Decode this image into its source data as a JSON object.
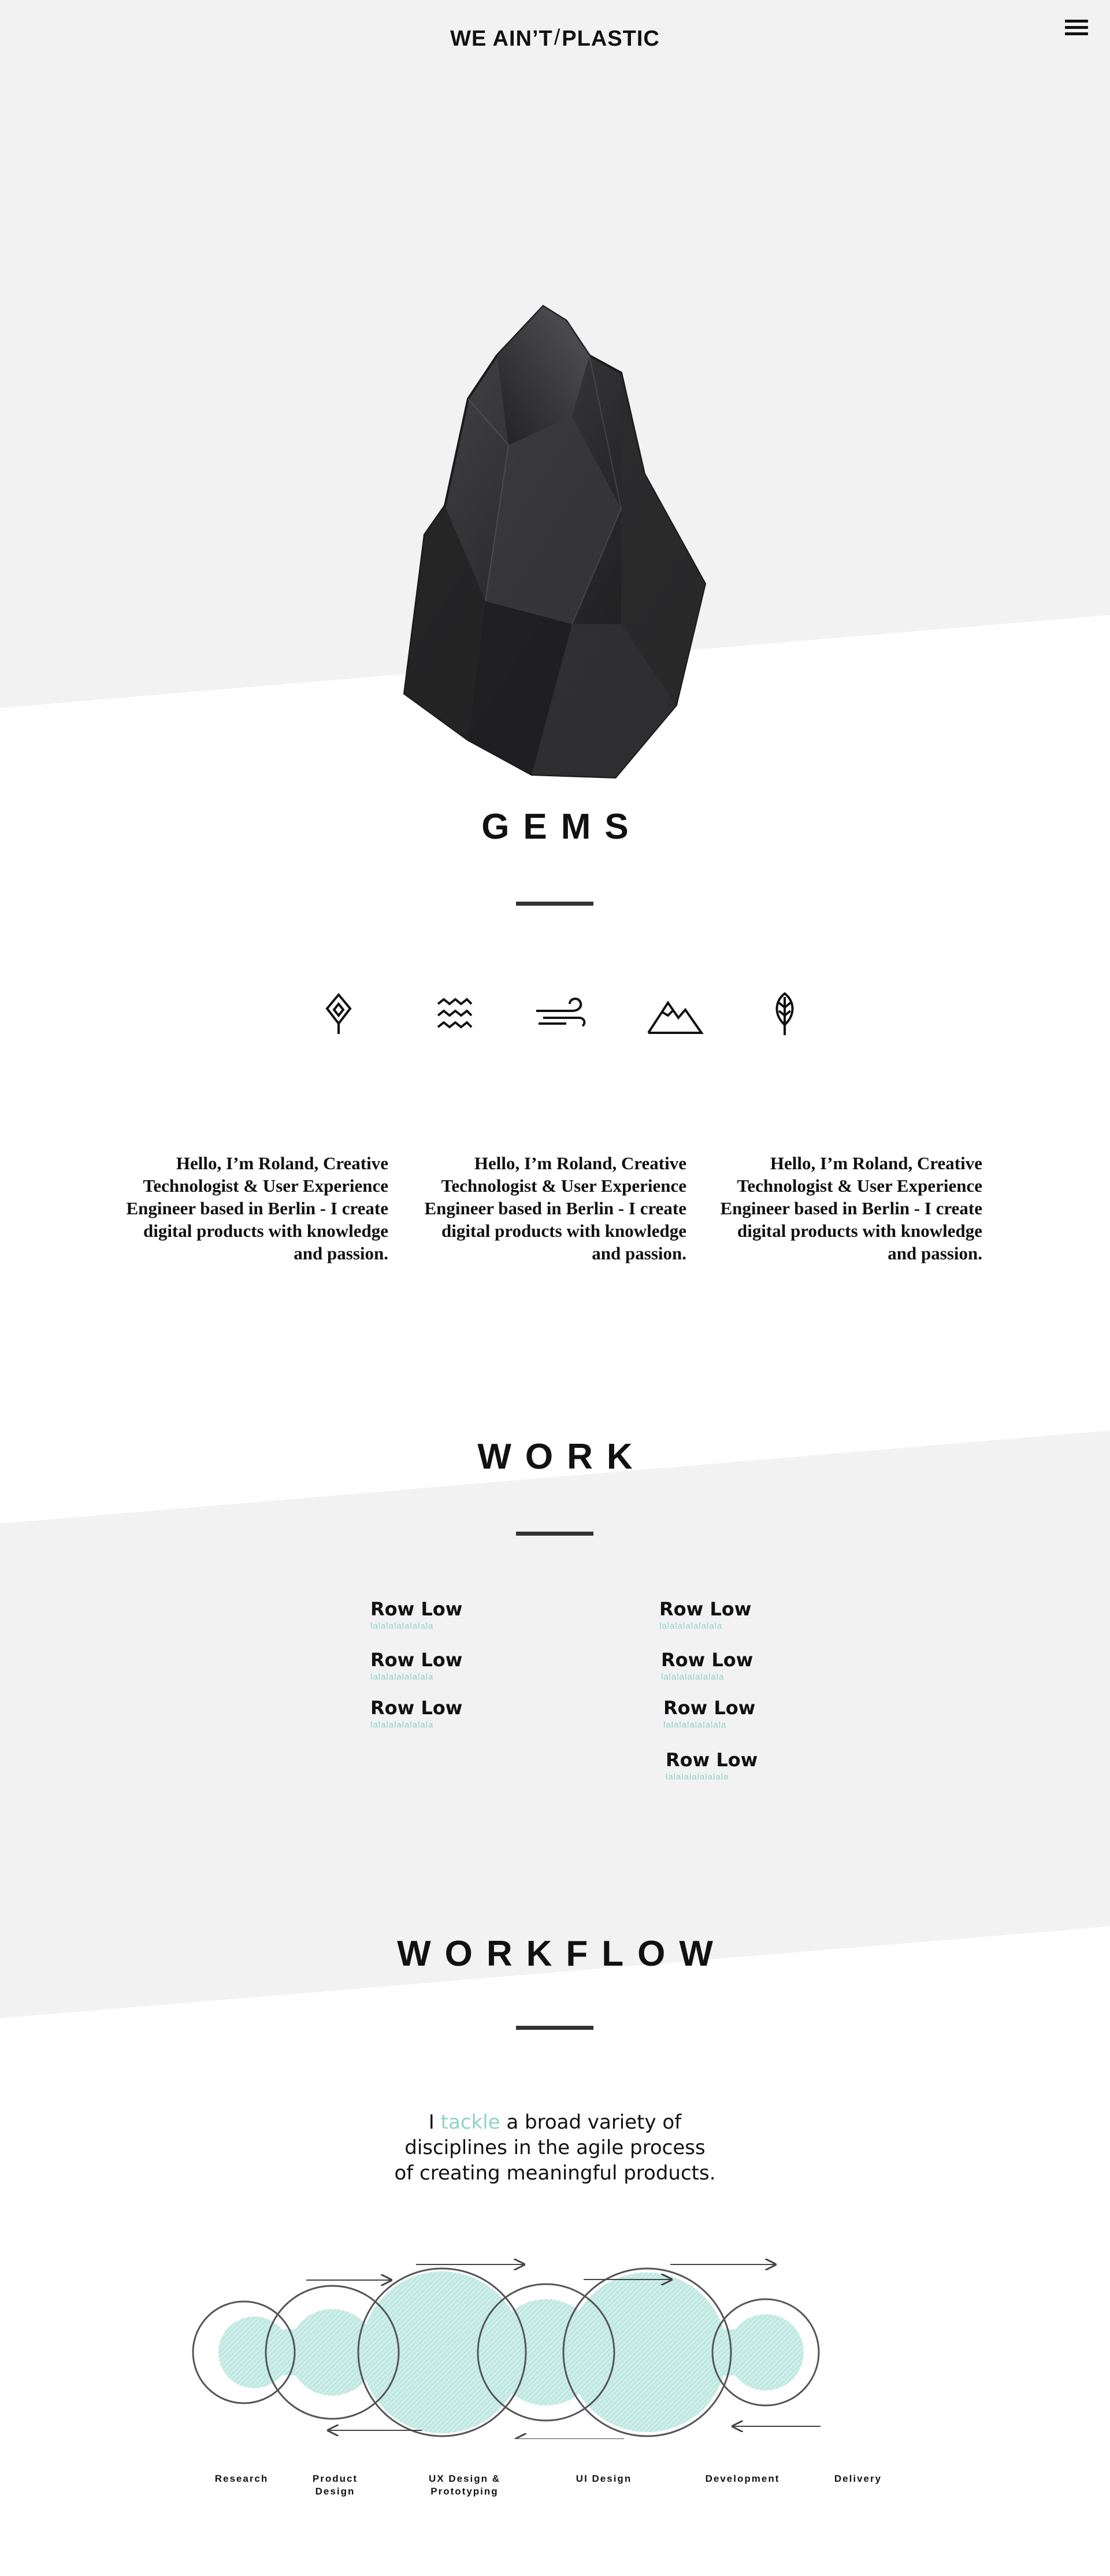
{
  "header": {
    "logo_left": "WE AIN’T",
    "logo_right": "PLASTIC",
    "menu_icon": "hamburger-menu-icon"
  },
  "hero": {
    "image": "black-gem-crystal",
    "title": "GEMS"
  },
  "gems_icons": [
    "leaf-diamond-icon",
    "waves-icon",
    "wind-icon",
    "mountain-icon",
    "feather-icon"
  ],
  "intro_columns": [
    {
      "text": "Hello, I’m Roland, Creative Technologist & User Experience Engineer based in Berlin - I create digital products with knowledge and passion."
    },
    {
      "text": "Hello, I’m Roland, Creative Technologist & User Experience Engineer based in Berlin - I create digital products with knowledge and passion."
    },
    {
      "text": "Hello, I’m Roland, Creative Technologist & User Experience Engineer based in Berlin - I create digital products with knowledge and passion."
    }
  ],
  "work": {
    "title": "WORK",
    "left_column": [
      {
        "title": "Row Low",
        "subtitle": "lalalalalalalala"
      },
      {
        "title": "Row Low",
        "subtitle": "lalalalalalalala"
      },
      {
        "title": "Row Low",
        "subtitle": "lalalalalalalala"
      }
    ],
    "right_column": [
      {
        "title": "Row Low",
        "subtitle": "lalalalalalalala"
      },
      {
        "title": "Row Low",
        "subtitle": "lalalalalalalala"
      },
      {
        "title": "Row Low",
        "subtitle": "lalalalalalalala"
      },
      {
        "title": "Row Low",
        "subtitle": "lalalalalalalala"
      }
    ]
  },
  "workflow": {
    "title": "WORKFLOW",
    "tagline_line1_pre": "I",
    "tagline_highlight": "tackle",
    "tagline_line1_post": "a broad variety of",
    "tagline_line2": "disciplines in the agile process",
    "tagline_line3": "of creating meaningful products.",
    "stages": [
      {
        "line1": "Research",
        "line2": ""
      },
      {
        "line1": "Product",
        "line2": "Design"
      },
      {
        "line1": "UX Design &",
        "line2": "Prototyping"
      },
      {
        "line1": "UI Design",
        "line2": ""
      },
      {
        "line1": "Development",
        "line2": ""
      },
      {
        "line1": "Delivery",
        "line2": ""
      }
    ]
  },
  "colors": {
    "background": "#ffffff",
    "band_gray": "#f2f2f2",
    "text": "#111111",
    "accent_mint": "#8fd3c8",
    "rule": "#333333"
  }
}
